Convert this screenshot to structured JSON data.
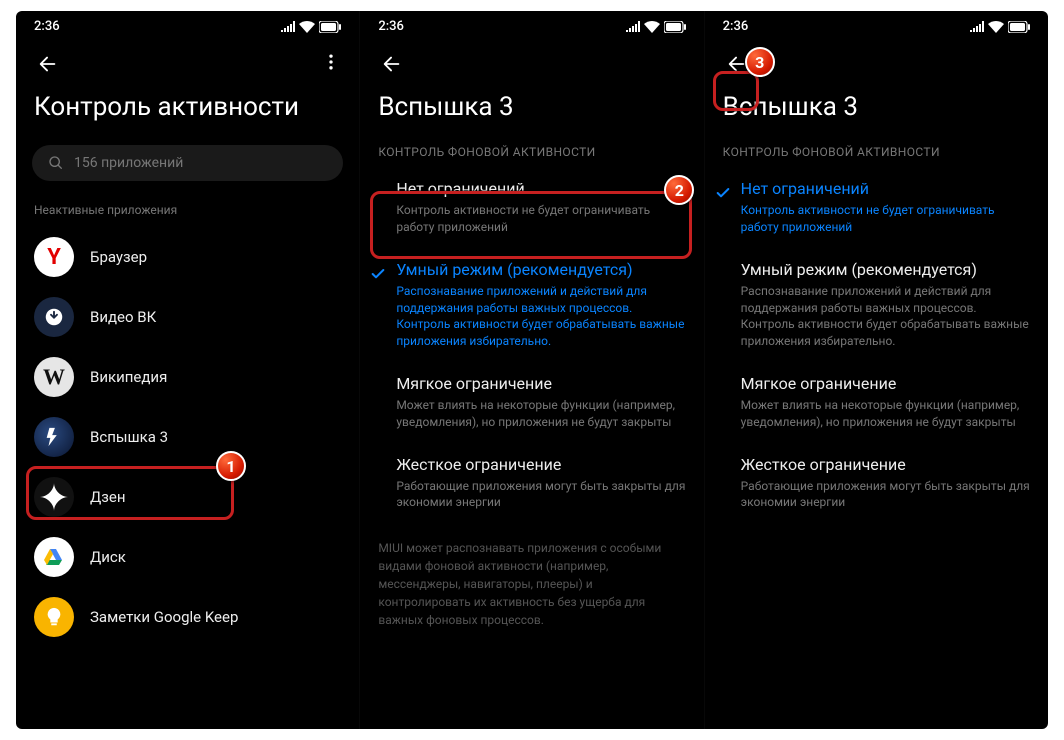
{
  "status": {
    "time": "2:36"
  },
  "screen1": {
    "title": "Контроль активности",
    "search_placeholder": "156 приложений",
    "section_label": "Неактивные приложения",
    "apps": [
      {
        "name": "Браузер"
      },
      {
        "name": "Видео ВК"
      },
      {
        "name": "Википедия"
      },
      {
        "name": "Вспышка 3"
      },
      {
        "name": "Дзен"
      },
      {
        "name": "Диск"
      },
      {
        "name": "Заметки Google Keep"
      }
    ]
  },
  "detail": {
    "title": "Вспышка 3",
    "section_label": "КОНТРОЛЬ ФОНОВОЙ АКТИВНОСТИ",
    "options": [
      {
        "title": "Нет ограничений",
        "desc": "Контроль активности не будет ограничивать работу приложений"
      },
      {
        "title": "Умный режим (рекомендуется)",
        "desc": "Распознавание приложений и действий для поддержания работы важных процессов. Контроль активности будет обрабатывать важные приложения избирательно."
      },
      {
        "title": "Мягкое ограничение",
        "desc": "Может влиять на некоторые функции (например, уведомления), но приложения не будут закрыты"
      },
      {
        "title": "Жесткое ограничение",
        "desc": "Работающие приложения могут быть закрыты для экономии энергии"
      }
    ],
    "info": "MIUI может распознавать приложения с особыми видами фоновой активности (например, мессенджеры, навигаторы, плееры) и контролировать их активность без ущерба для важных фоновых процессов."
  },
  "callouts": {
    "b1": "1",
    "b2": "2",
    "b3": "3"
  }
}
